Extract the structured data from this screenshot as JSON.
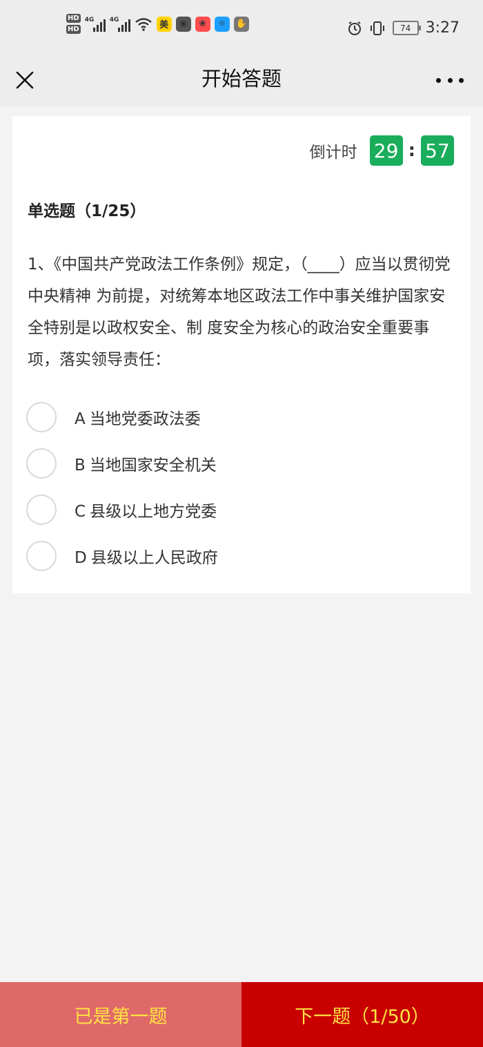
{
  "status_bar": {
    "hd1": "HD",
    "hd2": "HD",
    "net1": "4G",
    "net2": "4G",
    "battery": "74",
    "time": "3:27",
    "app_icons": [
      {
        "name": "meituan-icon",
        "glyph": "美",
        "color": "#ffd200"
      },
      {
        "name": "camera-icon",
        "glyph": "◉",
        "color": "#555555"
      },
      {
        "name": "app-red-icon",
        "glyph": "❀",
        "color": "#ff4d4f"
      },
      {
        "name": "lightbulb-icon",
        "glyph": "☼",
        "color": "#1e9fff"
      },
      {
        "name": "hand-icon",
        "glyph": "✋",
        "color": "#777777"
      }
    ]
  },
  "nav": {
    "title": "开始答题"
  },
  "timer": {
    "label": "倒计时",
    "minutes": "29",
    "separator": ":",
    "seconds": "57"
  },
  "question": {
    "type_label": "单选题（1/25）",
    "text": "1、《中国共产党政法工作条例》规定，（____）应当以贯彻党中央精神 为前提，对统筹本地区政法工作中事关维护国家安全特别是以政权安全、制 度安全为核心的政治安全重要事项，落实领导责任："
  },
  "options": [
    {
      "letter": "A",
      "text": "当地党委政法委"
    },
    {
      "letter": "B",
      "text": "当地国家安全机关"
    },
    {
      "letter": "C",
      "text": "县级以上地方党委"
    },
    {
      "letter": "D",
      "text": "县级以上人民政府"
    }
  ],
  "footer": {
    "prev_label": "已是第一题",
    "next_label": "下一题（1/50）"
  },
  "colors": {
    "timer_green": "#1aad5b",
    "prev_bg": "#df6969",
    "next_bg": "#c80000",
    "button_text": "#ffe342"
  }
}
